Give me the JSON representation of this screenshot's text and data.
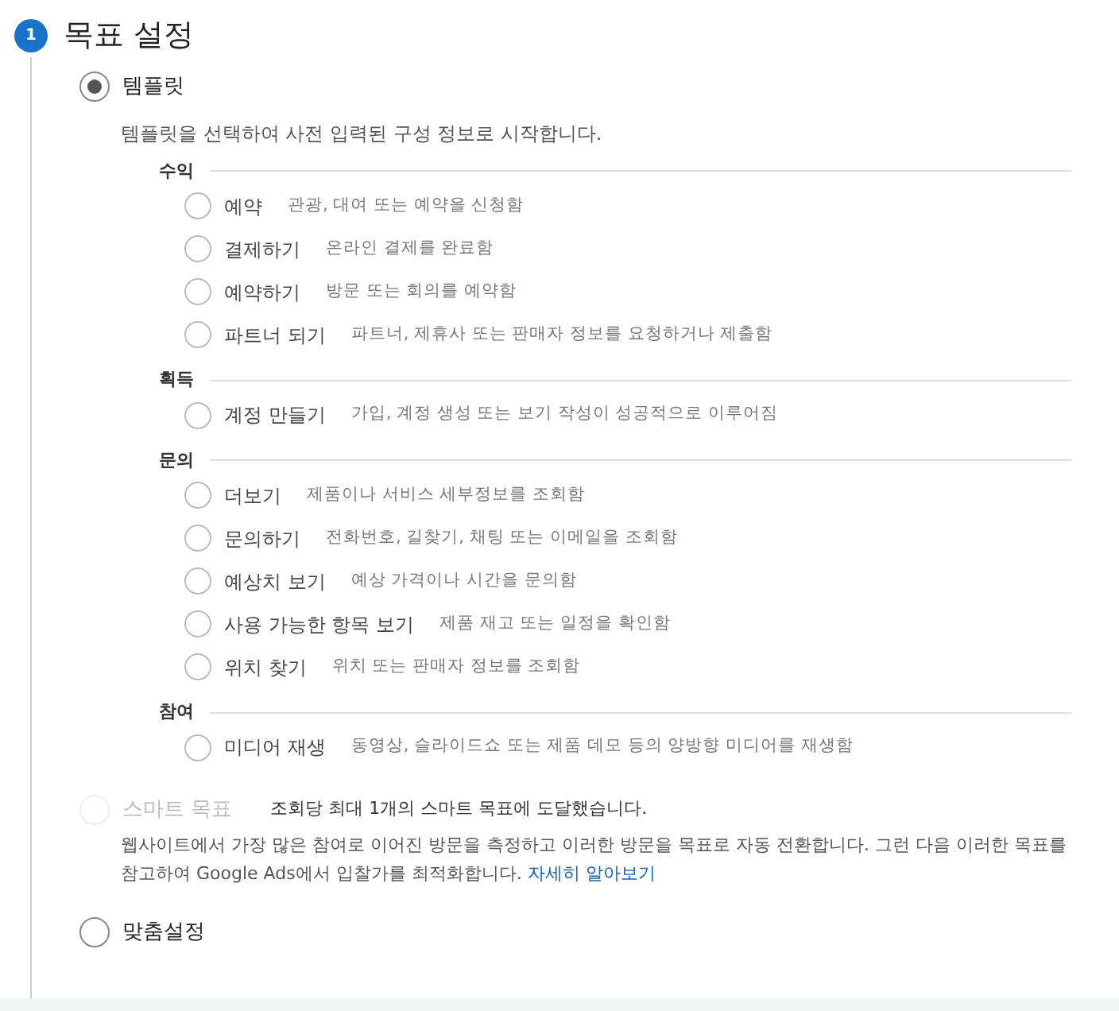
{
  "step": {
    "number": "1",
    "title": "목표 설정"
  },
  "options": [
    {
      "kind": "template",
      "label": "템플릿",
      "selected": true,
      "disabled": false,
      "description": "템플릿을 선택하여 사전 입력된 구성 정보로 시작합니다.",
      "groups": [
        {
          "heading": "수익",
          "goals": [
            {
              "name": "예약",
              "description": "관광, 대여 또는 예약을 신청함",
              "selected": false
            },
            {
              "name": "결제하기",
              "description": "온라인 결제를 완료함",
              "selected": false
            },
            {
              "name": "예약하기",
              "description": "방문 또는 회의를 예약함",
              "selected": false
            },
            {
              "name": "파트너 되기",
              "description": "파트너, 제휴사 또는 판매자 정보를 요청하거나 제출함",
              "selected": false
            }
          ]
        },
        {
          "heading": "획득",
          "goals": [
            {
              "name": "계정 만들기",
              "description": "가입, 계정 생성 또는 보기 작성이 성공적으로 이루어짐",
              "selected": false
            }
          ]
        },
        {
          "heading": "문의",
          "goals": [
            {
              "name": "더보기",
              "description": "제품이나 서비스 세부정보를 조회함",
              "selected": false
            },
            {
              "name": "문의하기",
              "description": "전화번호, 길찾기, 채팅 또는 이메일을 조회함",
              "selected": false
            },
            {
              "name": "예상치 보기",
              "description": "예상 가격이나 시간을 문의함",
              "selected": false
            },
            {
              "name": "사용 가능한 항목 보기",
              "description": "제품 재고 또는 일정을 확인함",
              "selected": false
            },
            {
              "name": "위치 찾기",
              "description": "위치 또는 판매자 정보를 조회함",
              "selected": false
            }
          ]
        },
        {
          "heading": "참여",
          "goals": [
            {
              "name": "미디어 재생",
              "description": "동영상, 슬라이드쇼 또는 제품 데모 등의 양방향 미디어를 재생함",
              "selected": false
            }
          ]
        }
      ]
    },
    {
      "kind": "smart",
      "label": "스마트 목표",
      "selected": false,
      "disabled": true,
      "note": "조회당 최대 1개의 스마트 목표에 도달했습니다.",
      "description": "웹사이트에서 가장 많은 참여로 이어진 방문을 측정하고 이러한 방문을 목표로 자동 전환합니다. 그런 다음 이러한 목표를 참고하여 Google Ads에서 입찰가를 최적화합니다.",
      "link": "자세히 알아보기"
    },
    {
      "kind": "custom",
      "label": "맞춤설정",
      "selected": false,
      "disabled": false
    }
  ]
}
